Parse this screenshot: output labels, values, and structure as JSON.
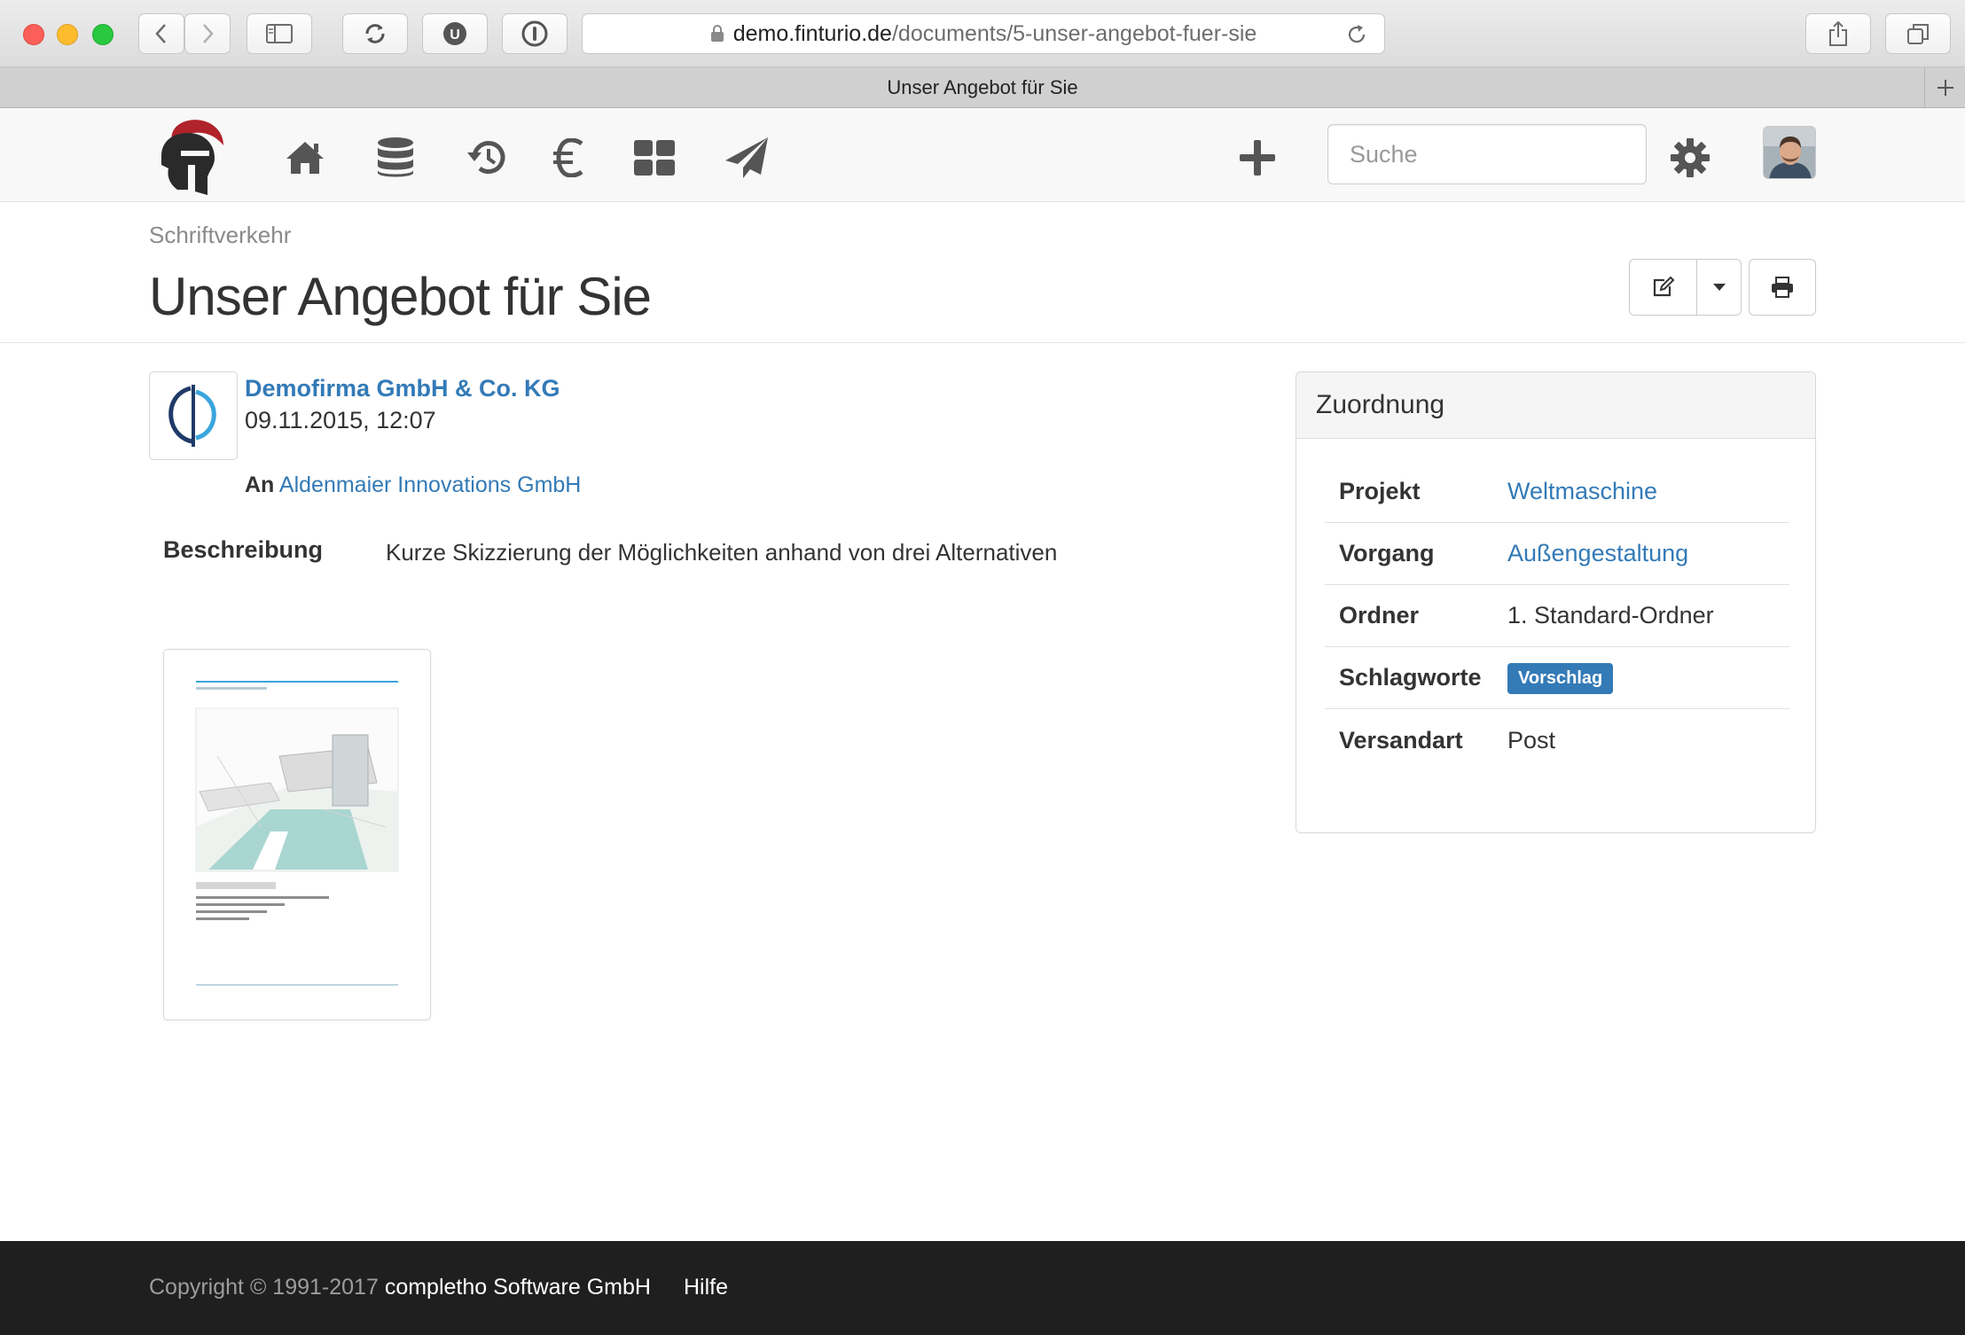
{
  "browser": {
    "url_host": "demo.finturio.de",
    "url_path": "/documents/5-unser-angebot-fuer-sie",
    "tab_title": "Unser Angebot für Sie"
  },
  "navbar": {
    "search_placeholder": "Suche",
    "icons": [
      "home-icon",
      "database-icon",
      "history-icon",
      "euro-icon",
      "grid-icon",
      "paper-plane-icon",
      "plus-icon",
      "gear-icon"
    ]
  },
  "header": {
    "breadcrumb": "Schriftverkehr",
    "title": "Unser Angebot für Sie"
  },
  "document": {
    "sender": "Demofirma GmbH & Co. KG",
    "date": "09.11.2015, 12:07",
    "recipient_label": "An",
    "recipient": "Aldenmaier Innovations GmbH",
    "description_label": "Beschreibung",
    "description": "Kurze Skizzierung der Möglichkeiten anhand von drei Alternativen"
  },
  "zuordnung": {
    "title": "Zuordnung",
    "rows": [
      {
        "key": "Projekt",
        "value": "Weltmaschine"
      },
      {
        "key": "Vorgang",
        "value": "Außengestaltung"
      },
      {
        "key": "Ordner",
        "value": "1. Standard-Ordner"
      },
      {
        "key": "Schlagworte",
        "value": "Vorschlag"
      },
      {
        "key": "Versandart",
        "value": "Post"
      }
    ]
  },
  "footer": {
    "copyright": "Copyright © 1991-2017",
    "company": "completho Software GmbH",
    "help": "Hilfe"
  },
  "colors": {
    "link": "#337ab7",
    "footer_bg": "#1f1f1f",
    "logo_red": "#b0232a"
  }
}
